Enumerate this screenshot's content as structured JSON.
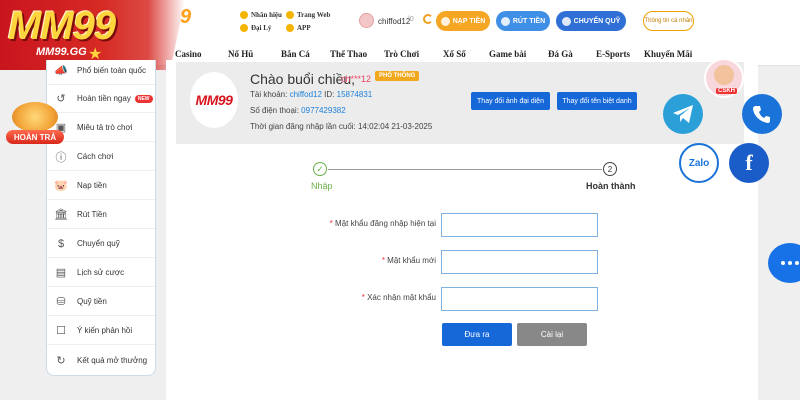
{
  "logo": {
    "main": "MM99",
    "sub": "MM99.GG",
    "tail": "9"
  },
  "header": {
    "links": [
      {
        "label": "Nhân hiệu",
        "icon": "trophy-icon"
      },
      {
        "label": "Trang Web",
        "icon": "globe-icon"
      },
      {
        "label": "Đại Lý",
        "icon": "diamond-icon"
      },
      {
        "label": "APP",
        "icon": "app-icon"
      }
    ],
    "username": "chiffod12",
    "separator": "|0",
    "buttons": {
      "deposit": "NẠP TIỀN",
      "withdraw": "RÚT TIỀN",
      "transfer": "CHUYỂN QUỸ"
    },
    "notice": "Thông tin cá nhân",
    "colors": {
      "deposit": "#f5a623",
      "withdraw": "#3f8fe6",
      "transfer": "#2f6fd6"
    }
  },
  "nav": [
    "Casino",
    "Nổ Hũ",
    "Bắn Cá",
    "Thể Thao",
    "Trò Chơi",
    "Xổ Số",
    "Game bài",
    "Đá Gà",
    "E-Sports",
    "Khuyến Mãi"
  ],
  "sidebar": {
    "items": [
      {
        "label": "Phổ biến toàn quốc",
        "icon": "megaphone-icon"
      },
      {
        "label": "Hoàn tiền ngay",
        "icon": "rebate-icon",
        "badge": "NEW"
      },
      {
        "label": "Miêu tả trò chơi",
        "icon": "game-icon"
      },
      {
        "label": "Cách chơi",
        "icon": "info-icon"
      },
      {
        "label": "Nạp tiền",
        "icon": "piggy-bank-icon"
      },
      {
        "label": "Rút Tiền",
        "icon": "bank-icon"
      },
      {
        "label": "Chuyển quỹ",
        "icon": "dollar-icon"
      },
      {
        "label": "Lịch sử cược",
        "icon": "history-doc-icon"
      },
      {
        "label": "Quỹ tiền",
        "icon": "coins-icon"
      },
      {
        "label": "Ý kiến phản hồi",
        "icon": "feedback-icon"
      },
      {
        "label": "Kết quả mở thưởng",
        "icon": "clock-history-icon"
      }
    ]
  },
  "promo": {
    "hoantra": "HOÀN TRẢ"
  },
  "profile": {
    "avatar_text": "MM99",
    "greeting": "Chào buổi chiều,",
    "masked_user": "ch***12",
    "vip": "PHỔ THÔNG",
    "account_label": "Tài khoản:",
    "account": "chiffod12",
    "id_label": "ID:",
    "id": "15874831",
    "phone_label": "Số điện thoại:",
    "phone": "0977429382",
    "last_login_label": "Thời gian đăng nhập lần cuối:",
    "last_login": "14:02:04 21-03-2025",
    "btn_avatar": "Thay đổi ảnh đại diện",
    "btn_nickname": "Thay đổi tên biệt danh"
  },
  "steps": [
    {
      "label": "Nhập",
      "mark": "✓"
    },
    {
      "label": "Hoàn thành",
      "mark": "2"
    }
  ],
  "form": {
    "required_mark": "*",
    "current_label": "Mật khẩu đăng nhập hiện tại",
    "new_label": "Mật khẩu mới",
    "confirm_label": "Xác nhận mật khẩu",
    "submit": "Đưa ra",
    "reset": "Cài lại"
  },
  "floating": {
    "cskh": "CSKH",
    "zalo": "Zalo",
    "facebook": "f"
  }
}
